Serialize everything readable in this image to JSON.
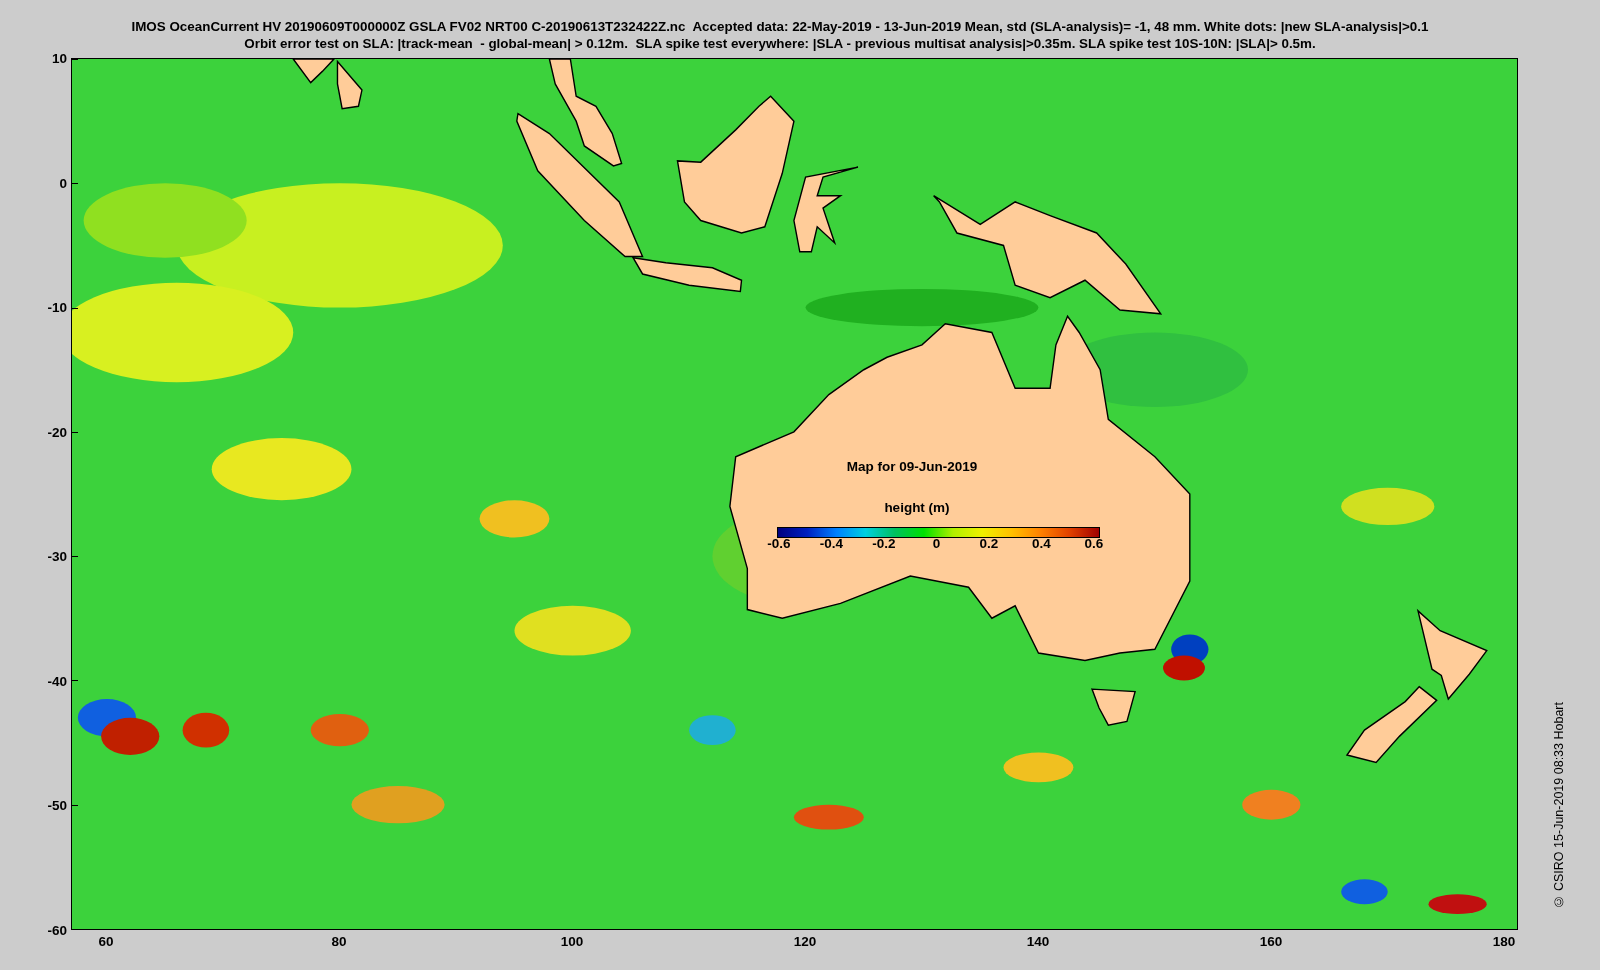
{
  "title_lines": [
    "IMOS OceanCurrent HV 20190609T000000Z GSLA FV02 NRT00 C-20190613T232422Z.nc  Accepted data: 22-May-2019 - 13-Jun-2019 Mean, std (SLA-analysis)= -1, 48 mm. White dots: |new SLA-analysis|>0.1",
    "Orbit error test on SLA: |track-mean  - global-mean| > 0.12m.  SLA spike test everywhere: |SLA - previous multisat analysis|>0.35m. SLA spike test 10S-10N: |SLA|> 0.5m."
  ],
  "map": {
    "y_ticks": [
      "10",
      "0",
      "-10",
      "-20",
      "-30",
      "-40",
      "-50",
      "-60"
    ],
    "x_ticks": [
      "60",
      "80",
      "100",
      "120",
      "140",
      "160",
      "180"
    ],
    "caption": "Map for 09-Jun-2019",
    "colorbar": {
      "label": "height (m)",
      "ticks": [
        "-0.6",
        "-0.4",
        "-0.2",
        "0",
        "0.2",
        "0.4",
        "0.6"
      ]
    }
  },
  "credit": "© CSIRO 15-Jun-2019 08:33 Hobart"
}
